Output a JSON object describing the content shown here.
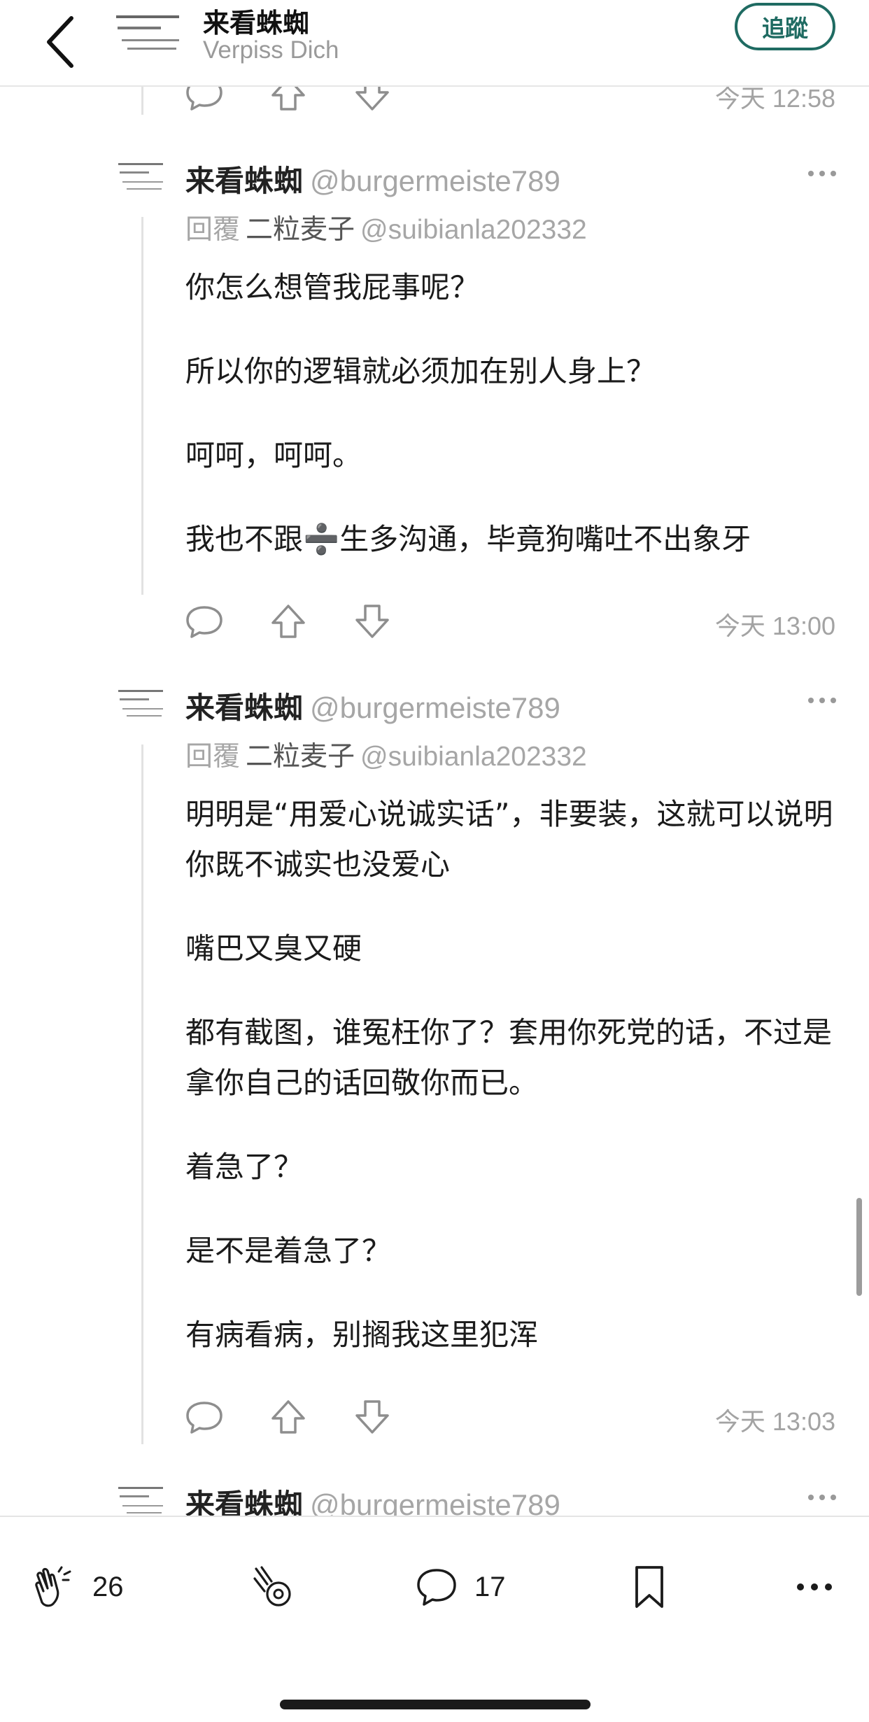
{
  "header": {
    "title": "来看蛛蜘",
    "subtitle": "Verpiss Dich",
    "follow_label": "追蹤"
  },
  "previous_comment": {
    "timestamp": "今天 12:58"
  },
  "comments": [
    {
      "author": "来看蛛蜘",
      "handle": "@burgermeiste789",
      "reply_prefix": "回覆",
      "reply_to_name": "二粒麦子",
      "reply_to_handle": "@suibianla202332",
      "paragraphs": [
        "你怎么想管我屁事呢？",
        "所以你的逻辑就必须加在别人身上？",
        "呵呵，呵呵。",
        "我也不跟➗生多沟通，毕竟狗嘴吐不出象牙"
      ],
      "timestamp": "今天 13:00"
    },
    {
      "author": "来看蛛蜘",
      "handle": "@burgermeiste789",
      "reply_prefix": "回覆",
      "reply_to_name": "二粒麦子",
      "reply_to_handle": "@suibianla202332",
      "paragraphs": [
        "明明是“用爱心说诚实话”，非要装，这就可以说明你既不诚实也没爱心",
        "嘴巴又臭又硬",
        "都有截图，谁冤枉你了？套用你死党的话，不过是拿你自己的话回敬你而已。",
        "着急了？",
        "是不是着急了？",
        "有病看病，别搁我这里犯浑"
      ],
      "timestamp": "今天 13:03"
    },
    {
      "author": "来看蛛蜘",
      "handle": "@burgermeiste789"
    }
  ],
  "bottom_bar": {
    "clap_count": "26",
    "comment_count": "17"
  }
}
